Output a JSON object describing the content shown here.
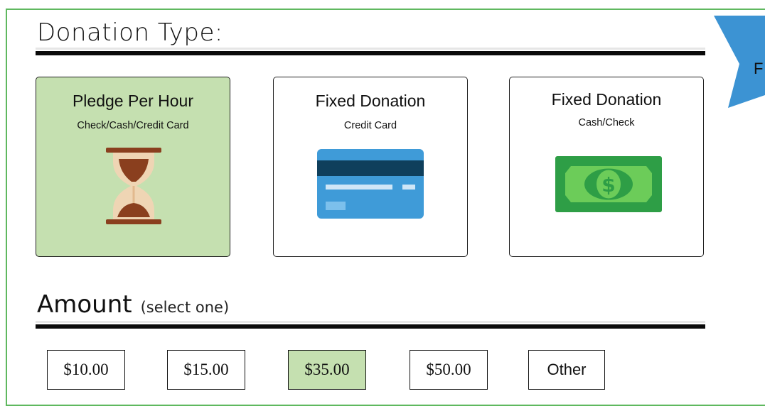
{
  "donation_type": {
    "title": "Donation Type:",
    "cards": [
      {
        "title": "Pledge Per Hour",
        "subtitle": "Check/Cash/Credit Card",
        "icon": "hourglass-icon",
        "selected": true
      },
      {
        "title": "Fixed Donation",
        "subtitle": "Credit Card",
        "icon": "credit-card-icon",
        "selected": false
      },
      {
        "title": "Fixed Donation",
        "subtitle": "Cash/Check",
        "icon": "dollar-bill-icon",
        "selected": false
      }
    ]
  },
  "amount": {
    "title": "Amount",
    "hint": "(select one)",
    "options": [
      {
        "label": "$10.00",
        "selected": false
      },
      {
        "label": "$15.00",
        "selected": false
      },
      {
        "label": "$35.00",
        "selected": true
      },
      {
        "label": "$50.00",
        "selected": false
      },
      {
        "label": "Other",
        "selected": false
      }
    ]
  },
  "ribbon": {
    "label": "F",
    "icon": "ribbon-banner-icon"
  },
  "colors": {
    "frame_border": "#5fb85f",
    "selected_fill": "#c5e0b0",
    "ribbon_blue": "#3c93d3",
    "card_blue": "#3f9bd8",
    "card_stripe": "#0f3f5c",
    "bill_green": "#2e9e46",
    "hourglass_wood": "#8a3f1e",
    "hourglass_sand": "#e8c7a0"
  }
}
